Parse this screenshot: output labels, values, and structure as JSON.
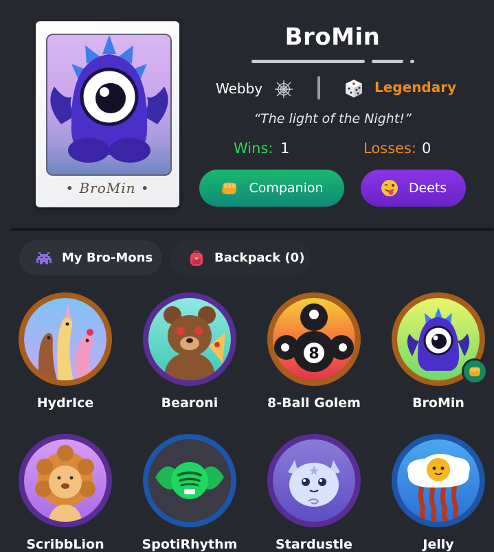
{
  "profile": {
    "card_caption": "• BroMin •",
    "name": "BroMin",
    "type_label": "Webby",
    "type_icon": "spider-web-icon",
    "rarity_icon": "dice-icon",
    "rarity": "Legendary",
    "quote": "“The light of the Night!”",
    "wins_label": "Wins:",
    "wins": "1",
    "losses_label": "Losses:",
    "losses": "0",
    "companion_button": "Companion",
    "deets_button": "Deets",
    "colors": {
      "wins": "#32d45a",
      "losses": "#f08a1f",
      "rarity": "#f08a1f",
      "companion": "#14885f",
      "deets": "#7a2be0"
    }
  },
  "tabs": [
    {
      "label": "My Bro-Mons",
      "icon": "space-invader-icon",
      "active": true
    },
    {
      "label": "Backpack (0)",
      "icon": "backpack-icon",
      "active": false
    }
  ],
  "mons": [
    {
      "name": "HydrIce",
      "ring": "bronze"
    },
    {
      "name": "Bearoni",
      "ring": "purple"
    },
    {
      "name": "8-Ball Golem",
      "ring": "bronze"
    },
    {
      "name": "BroMin",
      "ring": "bronze",
      "companion": true
    },
    {
      "name": "ScribbLion",
      "ring": "purple"
    },
    {
      "name": "SpotiRhythm",
      "ring": "blue"
    },
    {
      "name": "Stardustle",
      "ring": "purple"
    },
    {
      "name": "Jelly",
      "ring": "blue"
    }
  ]
}
